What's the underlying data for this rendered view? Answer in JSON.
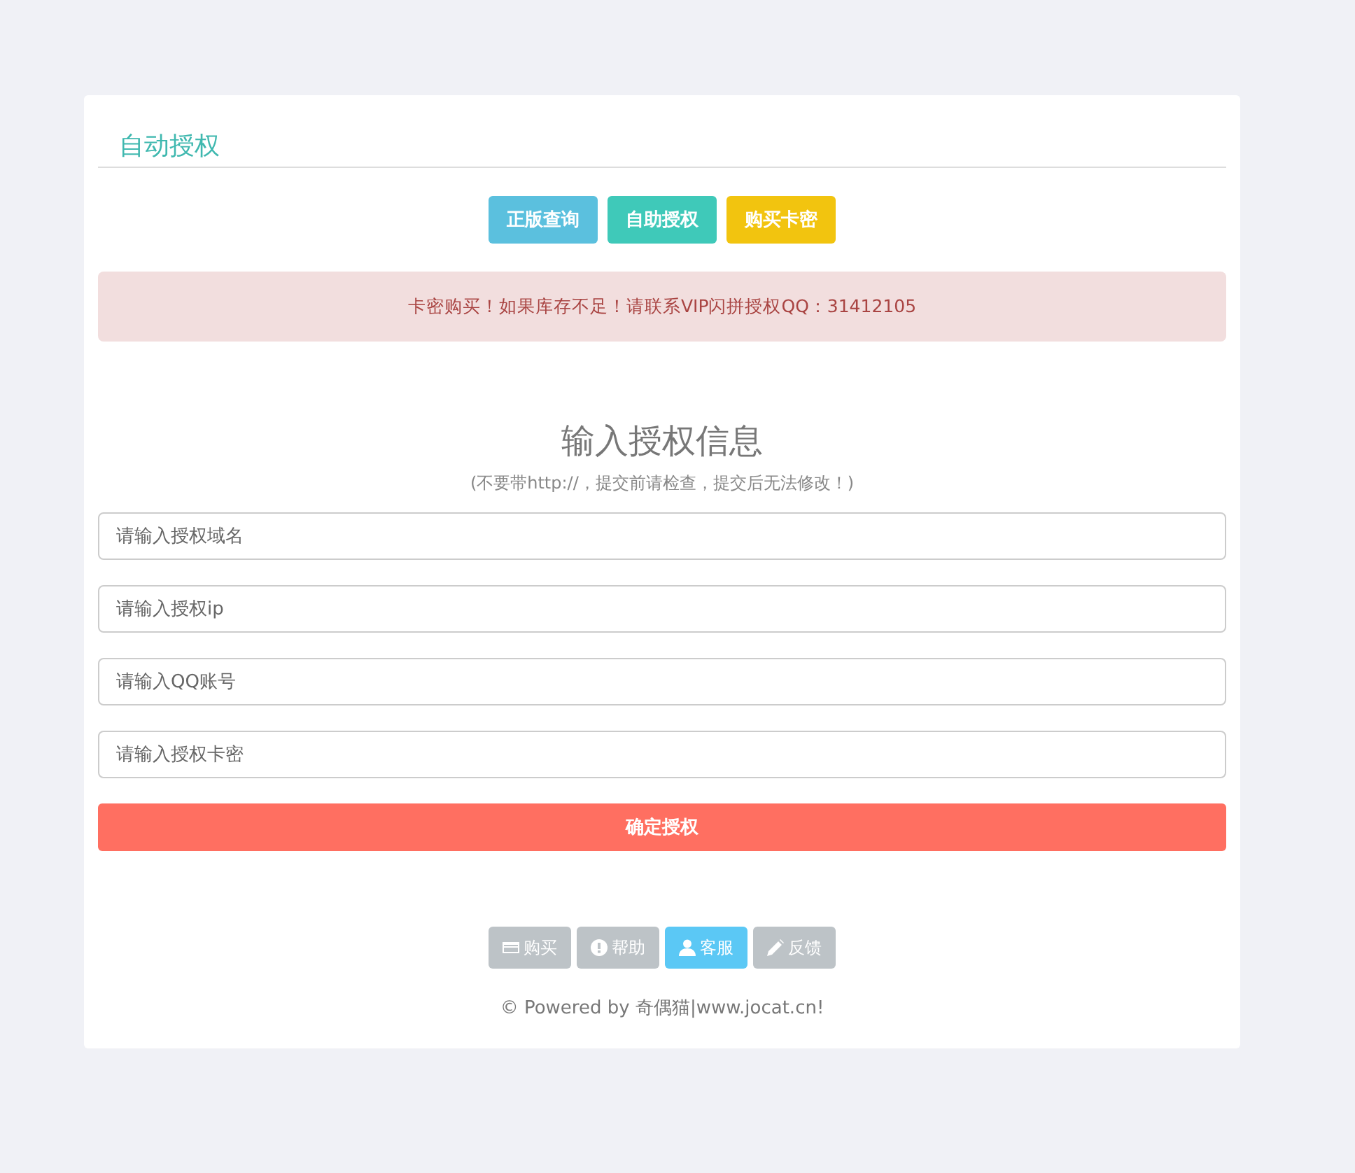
{
  "panel": {
    "title": "自动授权"
  },
  "top_buttons": [
    {
      "label": "正版查询",
      "color": "#5bc0de"
    },
    {
      "label": "自助授权",
      "color": "#3fc9b9"
    },
    {
      "label": "购买卡密",
      "color": "#f2c40f"
    }
  ],
  "alert": "卡密购买！如果库存不足！请联系VIP闪拼授权QQ：31412105",
  "form": {
    "heading": "输入授权信息",
    "note": "(不要带http://，提交前请检查，提交后无法修改！)",
    "fields": [
      {
        "placeholder": "请输入授权域名"
      },
      {
        "placeholder": "请输入授权ip"
      },
      {
        "placeholder": "请输入QQ账号"
      },
      {
        "placeholder": "请输入授权卡密"
      }
    ],
    "submit": "确定授权"
  },
  "footer_buttons": [
    {
      "label": "购买",
      "kind": "card",
      "color": "#bdc3c7"
    },
    {
      "label": "帮助",
      "kind": "alert",
      "color": "#bdc3c7"
    },
    {
      "label": "客服",
      "kind": "user",
      "color": "#5bc8f5"
    },
    {
      "label": "反馈",
      "kind": "pencil",
      "color": "#bdc3c7"
    }
  ],
  "copyright": "© Powered by 奇偶猫|www.jocat.cn!"
}
